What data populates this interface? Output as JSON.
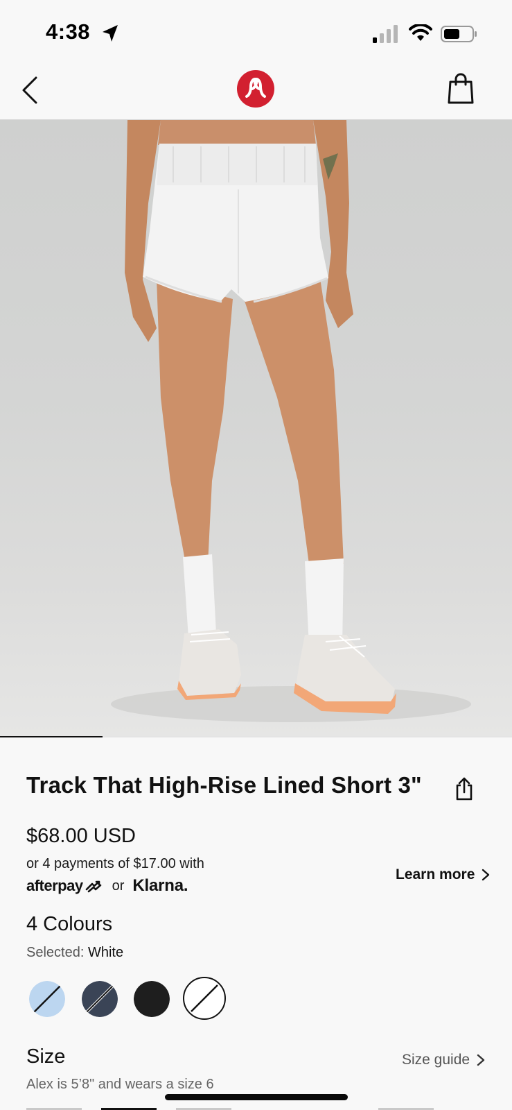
{
  "status_bar": {
    "time": "4:38",
    "icons": [
      "location-arrow-icon",
      "cellular-signal-icon",
      "wifi-icon",
      "battery-icon"
    ]
  },
  "nav": {
    "back_icon": "chevron-left-icon",
    "logo": "lululemon-logo",
    "bag_icon": "shopping-bag-icon"
  },
  "gallery": {
    "image": "product-photo-white-shorts",
    "progress": 0.2
  },
  "product": {
    "title": "Track That High-Rise Lined Short 3\"",
    "share_icon": "share-icon",
    "price": "$68.00 USD",
    "installments": "or 4 payments of $17.00 with",
    "afterpay": "afterpay",
    "or": "or",
    "klarna": "Klarna.",
    "learn_more": "Learn more"
  },
  "colours": {
    "heading": "4 Colours",
    "selected_label": "Selected:",
    "selected_value": "White",
    "swatches": [
      {
        "name": "light-blue",
        "color": "#bcd6f0"
      },
      {
        "name": "navy",
        "color": "#3a4456"
      },
      {
        "name": "black",
        "color": "#1e1e1e"
      },
      {
        "name": "white",
        "color": "#ffffff"
      }
    ]
  },
  "size": {
    "heading": "Size",
    "guide": "Size guide",
    "note": "Alex is 5’8\" and wears a size 6"
  },
  "colors": {
    "text": "#111111",
    "muted": "#555555",
    "brand": "#d22030",
    "background": "#f8f8f8"
  }
}
